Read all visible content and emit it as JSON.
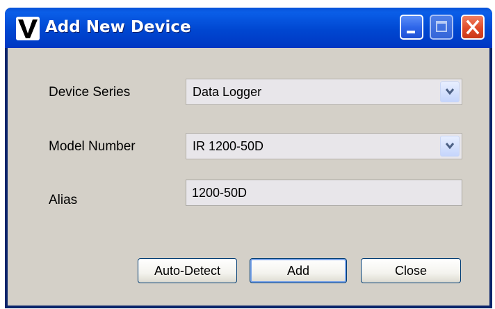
{
  "window": {
    "title": "Add New Device",
    "icon": "app-v-logo-icon",
    "controls": [
      "minimize",
      "maximize",
      "close"
    ]
  },
  "form": {
    "device_series": {
      "label": "Device Series",
      "value": "Data Logger"
    },
    "model_number": {
      "label": "Model Number",
      "value": "IR 1200-50D"
    },
    "alias": {
      "label": "Alias",
      "value": "1200-50D"
    }
  },
  "buttons": {
    "auto_detect": "Auto-Detect",
    "add": "Add",
    "close": "Close"
  },
  "colors": {
    "titlebar": "#0047d1",
    "client_background": "#d4d0c8",
    "close_button": "#e04a28"
  }
}
